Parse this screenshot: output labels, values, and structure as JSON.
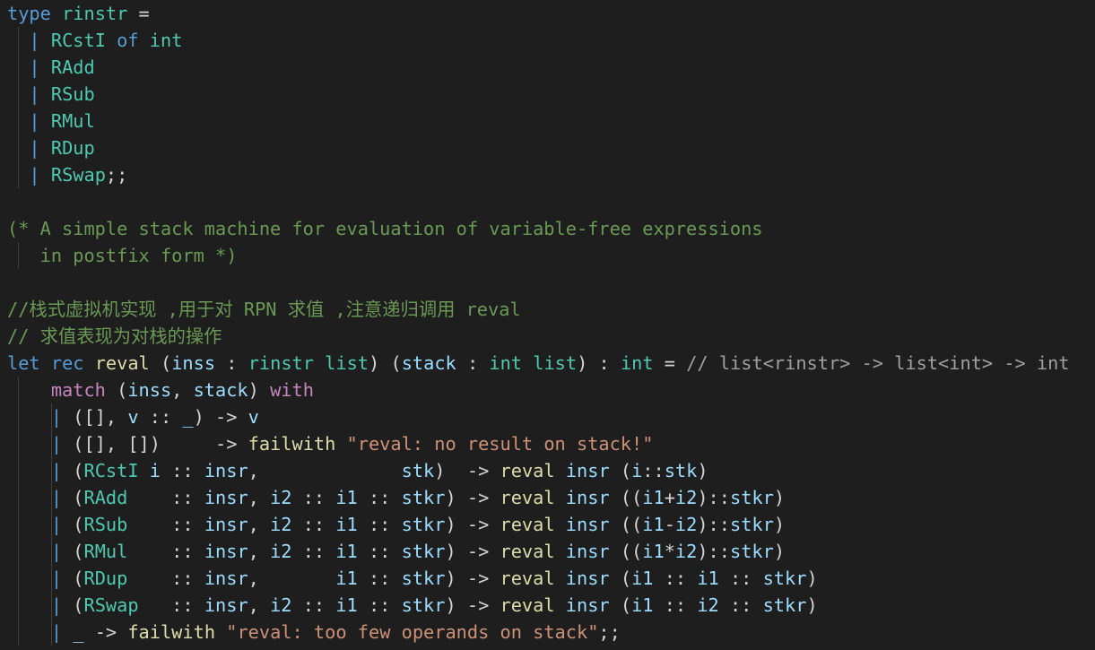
{
  "colors": {
    "background": "#1e1e1e",
    "default": "#d4d4d4",
    "keyword": "#569cd6",
    "control": "#c586c0",
    "type": "#4ec9b0",
    "variable": "#9cdcfe",
    "function": "#dcdcaa",
    "string": "#ce9178",
    "comment": "#6a9955",
    "number": "#b5cea8",
    "operator": "#d4d4d4",
    "hint": "#a0a0a0"
  },
  "code_lines": [
    {
      "guides": 0,
      "tokens": [
        [
          "type",
          "keyword"
        ],
        [
          " ",
          ""
        ],
        [
          "rinstr",
          "type"
        ],
        [
          " ",
          ""
        ],
        [
          "=",
          "operator"
        ]
      ]
    },
    {
      "guides": 1,
      "tokens": [
        [
          "  ",
          ""
        ],
        [
          "|",
          "keyword"
        ],
        [
          " ",
          ""
        ],
        [
          "RCstI",
          "type"
        ],
        [
          " ",
          ""
        ],
        [
          "of",
          "keyword"
        ],
        [
          " ",
          ""
        ],
        [
          "int",
          "type"
        ]
      ]
    },
    {
      "guides": 1,
      "tokens": [
        [
          "  ",
          ""
        ],
        [
          "|",
          "keyword"
        ],
        [
          " ",
          ""
        ],
        [
          "RAdd",
          "type"
        ]
      ]
    },
    {
      "guides": 1,
      "tokens": [
        [
          "  ",
          ""
        ],
        [
          "|",
          "keyword"
        ],
        [
          " ",
          ""
        ],
        [
          "RSub",
          "type"
        ]
      ]
    },
    {
      "guides": 1,
      "tokens": [
        [
          "  ",
          ""
        ],
        [
          "|",
          "keyword"
        ],
        [
          " ",
          ""
        ],
        [
          "RMul",
          "type"
        ]
      ]
    },
    {
      "guides": 1,
      "tokens": [
        [
          "  ",
          ""
        ],
        [
          "|",
          "keyword"
        ],
        [
          " ",
          ""
        ],
        [
          "RDup",
          "type"
        ]
      ]
    },
    {
      "guides": 1,
      "tokens": [
        [
          "  ",
          ""
        ],
        [
          "|",
          "keyword"
        ],
        [
          " ",
          ""
        ],
        [
          "RSwap",
          "type"
        ],
        [
          ";;",
          "default"
        ]
      ]
    },
    {
      "guides": 0,
      "tokens": []
    },
    {
      "guides": 0,
      "tokens": [
        [
          "(* A simple stack machine for evaluation of variable-free expressions",
          "comment"
        ]
      ]
    },
    {
      "guides": 1,
      "tokens": [
        [
          "   in postfix form *)",
          "comment"
        ]
      ]
    },
    {
      "guides": 0,
      "tokens": []
    },
    {
      "guides": 0,
      "tokens": [
        [
          "//栈式虚拟机实现 ,用于对 RPN 求值 ,注意递归调用 reval",
          "comment"
        ]
      ]
    },
    {
      "guides": 0,
      "tokens": [
        [
          "// 求值表现为对栈的操作",
          "comment"
        ]
      ]
    },
    {
      "guides": 0,
      "tokens": [
        [
          "let",
          "keyword"
        ],
        [
          " ",
          ""
        ],
        [
          "rec",
          "keyword"
        ],
        [
          " ",
          ""
        ],
        [
          "reval",
          "function"
        ],
        [
          " ",
          ""
        ],
        [
          "(",
          "default"
        ],
        [
          "inss",
          "variable"
        ],
        [
          " : ",
          "default"
        ],
        [
          "rinstr list",
          "type"
        ],
        [
          ")",
          "default"
        ],
        [
          " ",
          ""
        ],
        [
          "(",
          "default"
        ],
        [
          "stack",
          "variable"
        ],
        [
          " : ",
          "default"
        ],
        [
          "int list",
          "type"
        ],
        [
          ")",
          "default"
        ],
        [
          " : ",
          "default"
        ],
        [
          "int",
          "type"
        ],
        [
          " = ",
          "default"
        ],
        [
          "// list<rinstr> -> list<int> -> int",
          "hint"
        ]
      ]
    },
    {
      "guides": 1,
      "tokens": [
        [
          "    ",
          ""
        ],
        [
          "match",
          "control"
        ],
        [
          " (",
          "default"
        ],
        [
          "inss",
          "variable"
        ],
        [
          ", ",
          "default"
        ],
        [
          "stack",
          "variable"
        ],
        [
          ") ",
          "default"
        ],
        [
          "with",
          "control"
        ]
      ]
    },
    {
      "guides": 2,
      "tokens": [
        [
          "    ",
          ""
        ],
        [
          "|",
          "keyword"
        ],
        [
          " ([], ",
          "default"
        ],
        [
          "v",
          "variable"
        ],
        [
          " :: ",
          "default"
        ],
        [
          "_",
          "variable"
        ],
        [
          ") -> ",
          "default"
        ],
        [
          "v",
          "variable"
        ]
      ]
    },
    {
      "guides": 2,
      "tokens": [
        [
          "    ",
          ""
        ],
        [
          "|",
          "keyword"
        ],
        [
          " ([], [])     -> ",
          "default"
        ],
        [
          "failwith",
          "function"
        ],
        [
          " ",
          ""
        ],
        [
          "\"reval: no result on stack!\"",
          "string"
        ]
      ]
    },
    {
      "guides": 2,
      "tokens": [
        [
          "    ",
          ""
        ],
        [
          "|",
          "keyword"
        ],
        [
          " (",
          "default"
        ],
        [
          "RCstI",
          "type"
        ],
        [
          " ",
          ""
        ],
        [
          "i",
          "variable"
        ],
        [
          " :: ",
          "default"
        ],
        [
          "insr",
          "variable"
        ],
        [
          ",             ",
          "default"
        ],
        [
          "stk",
          "variable"
        ],
        [
          ")  -> ",
          "default"
        ],
        [
          "reval",
          "function"
        ],
        [
          " ",
          ""
        ],
        [
          "insr",
          "variable"
        ],
        [
          " (",
          "default"
        ],
        [
          "i",
          "variable"
        ],
        [
          "::",
          "default"
        ],
        [
          "stk",
          "variable"
        ],
        [
          ")",
          "default"
        ]
      ]
    },
    {
      "guides": 2,
      "tokens": [
        [
          "    ",
          ""
        ],
        [
          "|",
          "keyword"
        ],
        [
          " (",
          "default"
        ],
        [
          "RAdd",
          "type"
        ],
        [
          "    :: ",
          "default"
        ],
        [
          "insr",
          "variable"
        ],
        [
          ", ",
          "default"
        ],
        [
          "i2",
          "variable"
        ],
        [
          " :: ",
          "default"
        ],
        [
          "i1",
          "variable"
        ],
        [
          " :: ",
          "default"
        ],
        [
          "stkr",
          "variable"
        ],
        [
          ") -> ",
          "default"
        ],
        [
          "reval",
          "function"
        ],
        [
          " ",
          ""
        ],
        [
          "insr",
          "variable"
        ],
        [
          " ((",
          "default"
        ],
        [
          "i1",
          "variable"
        ],
        [
          "+",
          "default"
        ],
        [
          "i2",
          "variable"
        ],
        [
          ")::",
          "default"
        ],
        [
          "stkr",
          "variable"
        ],
        [
          ")",
          "default"
        ]
      ]
    },
    {
      "guides": 2,
      "tokens": [
        [
          "    ",
          ""
        ],
        [
          "|",
          "keyword"
        ],
        [
          " (",
          "default"
        ],
        [
          "RSub",
          "type"
        ],
        [
          "    :: ",
          "default"
        ],
        [
          "insr",
          "variable"
        ],
        [
          ", ",
          "default"
        ],
        [
          "i2",
          "variable"
        ],
        [
          " :: ",
          "default"
        ],
        [
          "i1",
          "variable"
        ],
        [
          " :: ",
          "default"
        ],
        [
          "stkr",
          "variable"
        ],
        [
          ") -> ",
          "default"
        ],
        [
          "reval",
          "function"
        ],
        [
          " ",
          ""
        ],
        [
          "insr",
          "variable"
        ],
        [
          " ((",
          "default"
        ],
        [
          "i1",
          "variable"
        ],
        [
          "-",
          "default"
        ],
        [
          "i2",
          "variable"
        ],
        [
          ")::",
          "default"
        ],
        [
          "stkr",
          "variable"
        ],
        [
          ")",
          "default"
        ]
      ]
    },
    {
      "guides": 2,
      "tokens": [
        [
          "    ",
          ""
        ],
        [
          "|",
          "keyword"
        ],
        [
          " (",
          "default"
        ],
        [
          "RMul",
          "type"
        ],
        [
          "    :: ",
          "default"
        ],
        [
          "insr",
          "variable"
        ],
        [
          ", ",
          "default"
        ],
        [
          "i2",
          "variable"
        ],
        [
          " :: ",
          "default"
        ],
        [
          "i1",
          "variable"
        ],
        [
          " :: ",
          "default"
        ],
        [
          "stkr",
          "variable"
        ],
        [
          ") -> ",
          "default"
        ],
        [
          "reval",
          "function"
        ],
        [
          " ",
          ""
        ],
        [
          "insr",
          "variable"
        ],
        [
          " ((",
          "default"
        ],
        [
          "i1",
          "variable"
        ],
        [
          "*",
          "default"
        ],
        [
          "i2",
          "variable"
        ],
        [
          ")::",
          "default"
        ],
        [
          "stkr",
          "variable"
        ],
        [
          ")",
          "default"
        ]
      ]
    },
    {
      "guides": 2,
      "tokens": [
        [
          "    ",
          ""
        ],
        [
          "|",
          "keyword"
        ],
        [
          " (",
          "default"
        ],
        [
          "RDup",
          "type"
        ],
        [
          "    :: ",
          "default"
        ],
        [
          "insr",
          "variable"
        ],
        [
          ",       ",
          "default"
        ],
        [
          "i1",
          "variable"
        ],
        [
          " :: ",
          "default"
        ],
        [
          "stkr",
          "variable"
        ],
        [
          ") -> ",
          "default"
        ],
        [
          "reval",
          "function"
        ],
        [
          " ",
          ""
        ],
        [
          "insr",
          "variable"
        ],
        [
          " (",
          "default"
        ],
        [
          "i1",
          "variable"
        ],
        [
          " :: ",
          "default"
        ],
        [
          "i1",
          "variable"
        ],
        [
          " :: ",
          "default"
        ],
        [
          "stkr",
          "variable"
        ],
        [
          ")",
          "default"
        ]
      ]
    },
    {
      "guides": 2,
      "tokens": [
        [
          "    ",
          ""
        ],
        [
          "|",
          "keyword"
        ],
        [
          " (",
          "default"
        ],
        [
          "RSwap",
          "type"
        ],
        [
          "   :: ",
          "default"
        ],
        [
          "insr",
          "variable"
        ],
        [
          ", ",
          "default"
        ],
        [
          "i2",
          "variable"
        ],
        [
          " :: ",
          "default"
        ],
        [
          "i1",
          "variable"
        ],
        [
          " :: ",
          "default"
        ],
        [
          "stkr",
          "variable"
        ],
        [
          ") -> ",
          "default"
        ],
        [
          "reval",
          "function"
        ],
        [
          " ",
          ""
        ],
        [
          "insr",
          "variable"
        ],
        [
          " (",
          "default"
        ],
        [
          "i1",
          "variable"
        ],
        [
          " :: ",
          "default"
        ],
        [
          "i2",
          "variable"
        ],
        [
          " :: ",
          "default"
        ],
        [
          "stkr",
          "variable"
        ],
        [
          ")",
          "default"
        ]
      ]
    },
    {
      "guides": 2,
      "tokens": [
        [
          "    ",
          ""
        ],
        [
          "|",
          "keyword"
        ],
        [
          " ",
          ""
        ],
        [
          "_",
          "variable"
        ],
        [
          " -> ",
          "default"
        ],
        [
          "failwith",
          "function"
        ],
        [
          " ",
          ""
        ],
        [
          "\"reval: too few operands on stack\"",
          "string"
        ],
        [
          ";;",
          "default"
        ]
      ]
    }
  ]
}
